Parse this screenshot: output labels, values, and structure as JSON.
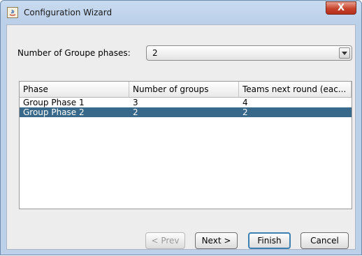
{
  "window": {
    "title": "Configuration Wizard",
    "close_label": "X"
  },
  "phases": {
    "label": "Number of Groupe phases:",
    "selected": "2"
  },
  "table": {
    "columns": [
      "Phase",
      "Number of groups",
      "Teams next round (eac..."
    ],
    "rows": [
      {
        "phase": "Group Phase 1",
        "groups": "3",
        "teams": "4"
      },
      {
        "phase": "Group Phase 2",
        "groups": "2",
        "teams": "2"
      }
    ]
  },
  "buttons": {
    "prev": "< Prev",
    "next": "Next >",
    "finish": "Finish",
    "cancel": "Cancel"
  }
}
